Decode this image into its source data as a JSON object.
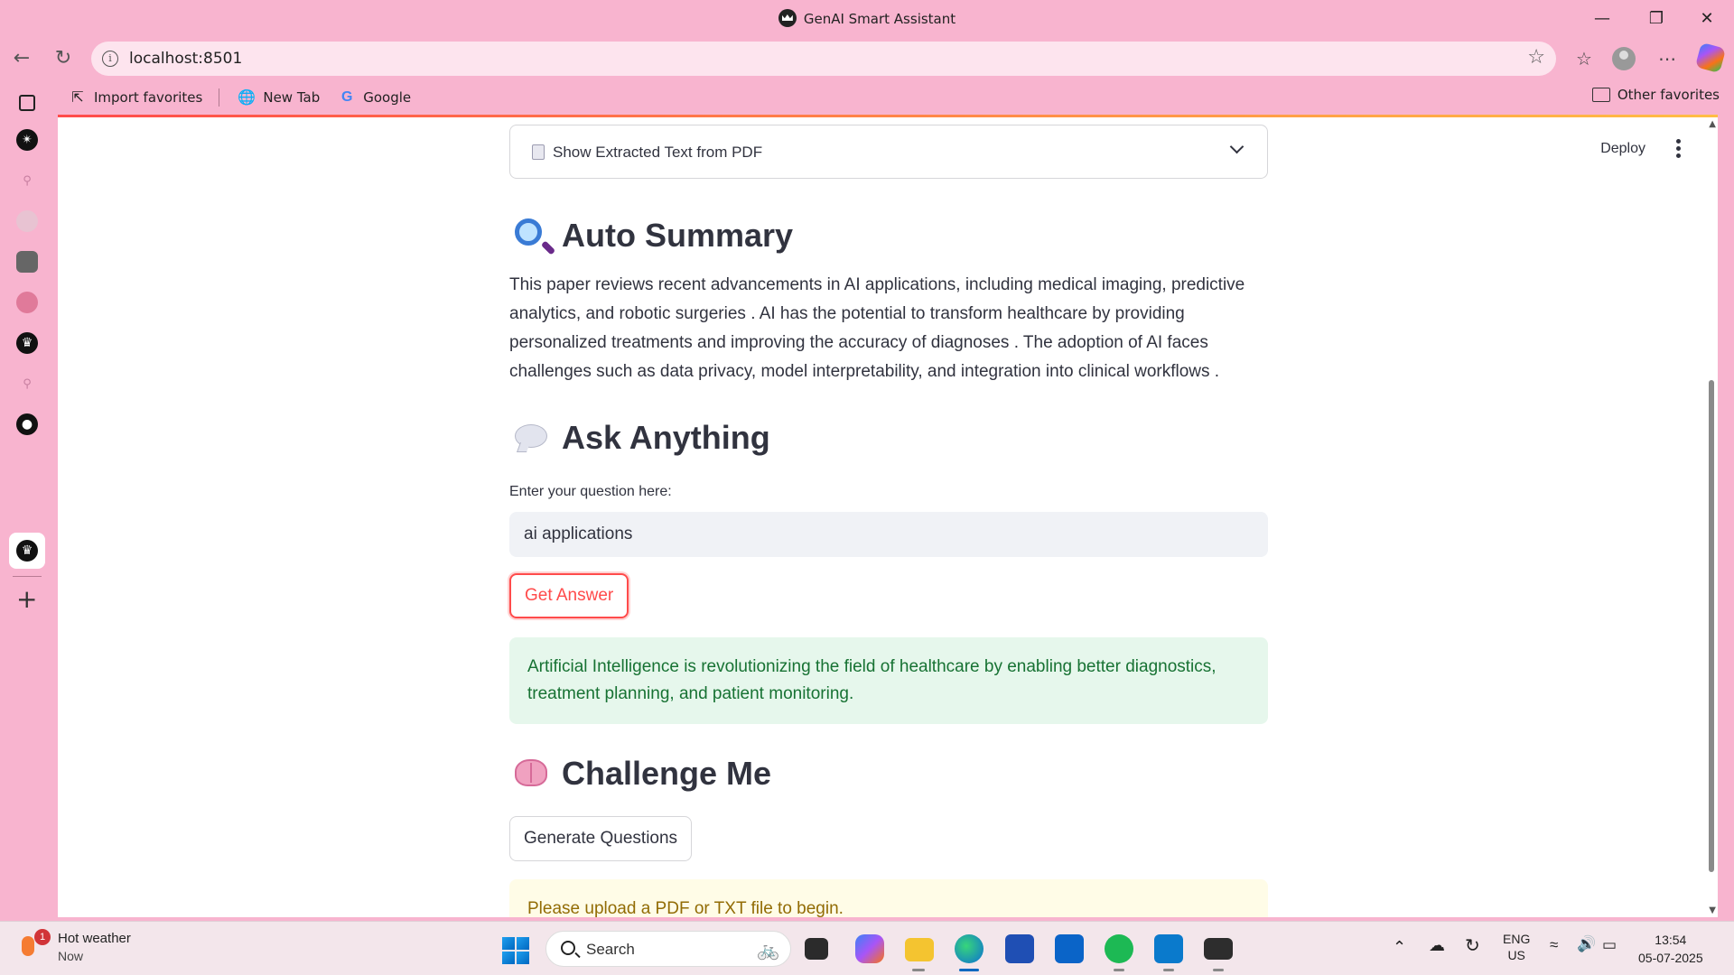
{
  "window": {
    "title": "GenAI Smart Assistant"
  },
  "browser": {
    "url": "localhost:8501",
    "favorites": [
      {
        "label": "Import favorites",
        "icon": "import-icon"
      },
      {
        "label": "New Tab",
        "icon": "globe-icon"
      },
      {
        "label": "Google",
        "icon": "google-icon"
      }
    ],
    "other_favorites": "Other favorites"
  },
  "app": {
    "deploy_label": "Deploy",
    "expander_label": "Show Extracted Text from PDF",
    "summary": {
      "heading": "Auto Summary",
      "text": "This paper reviews recent advancements in AI applications, including medical imaging, predictive analytics, and robotic surgeries . AI has the potential to transform healthcare by providing personalized treatments and improving the accuracy of diagnoses . The adoption of AI faces challenges such as data privacy, model interpretability, and integration into clinical workflows ."
    },
    "ask": {
      "heading": "Ask Anything",
      "input_label": "Enter your question here:",
      "input_value": "ai applications",
      "button_label": "Get Answer",
      "answer": "Artificial Intelligence is revolutionizing the field of healthcare by enabling better diagnostics, treatment planning, and patient monitoring."
    },
    "challenge": {
      "heading": "Challenge Me",
      "button_label": "Generate Questions",
      "warning": "Please upload a PDF or TXT file to begin."
    },
    "colors": {
      "primary": "#ff4b4b",
      "success_bg": "#e6f7ec",
      "success_text": "#177233",
      "warning_bg": "#fffce7",
      "warning_text": "#926c05"
    }
  },
  "taskbar": {
    "weather_title": "Hot weather",
    "weather_sub": "Now",
    "weather_badge": "1",
    "search_placeholder": "Search",
    "lang_top": "ENG",
    "lang_bottom": "US",
    "time": "13:54",
    "date": "05-07-2025"
  }
}
